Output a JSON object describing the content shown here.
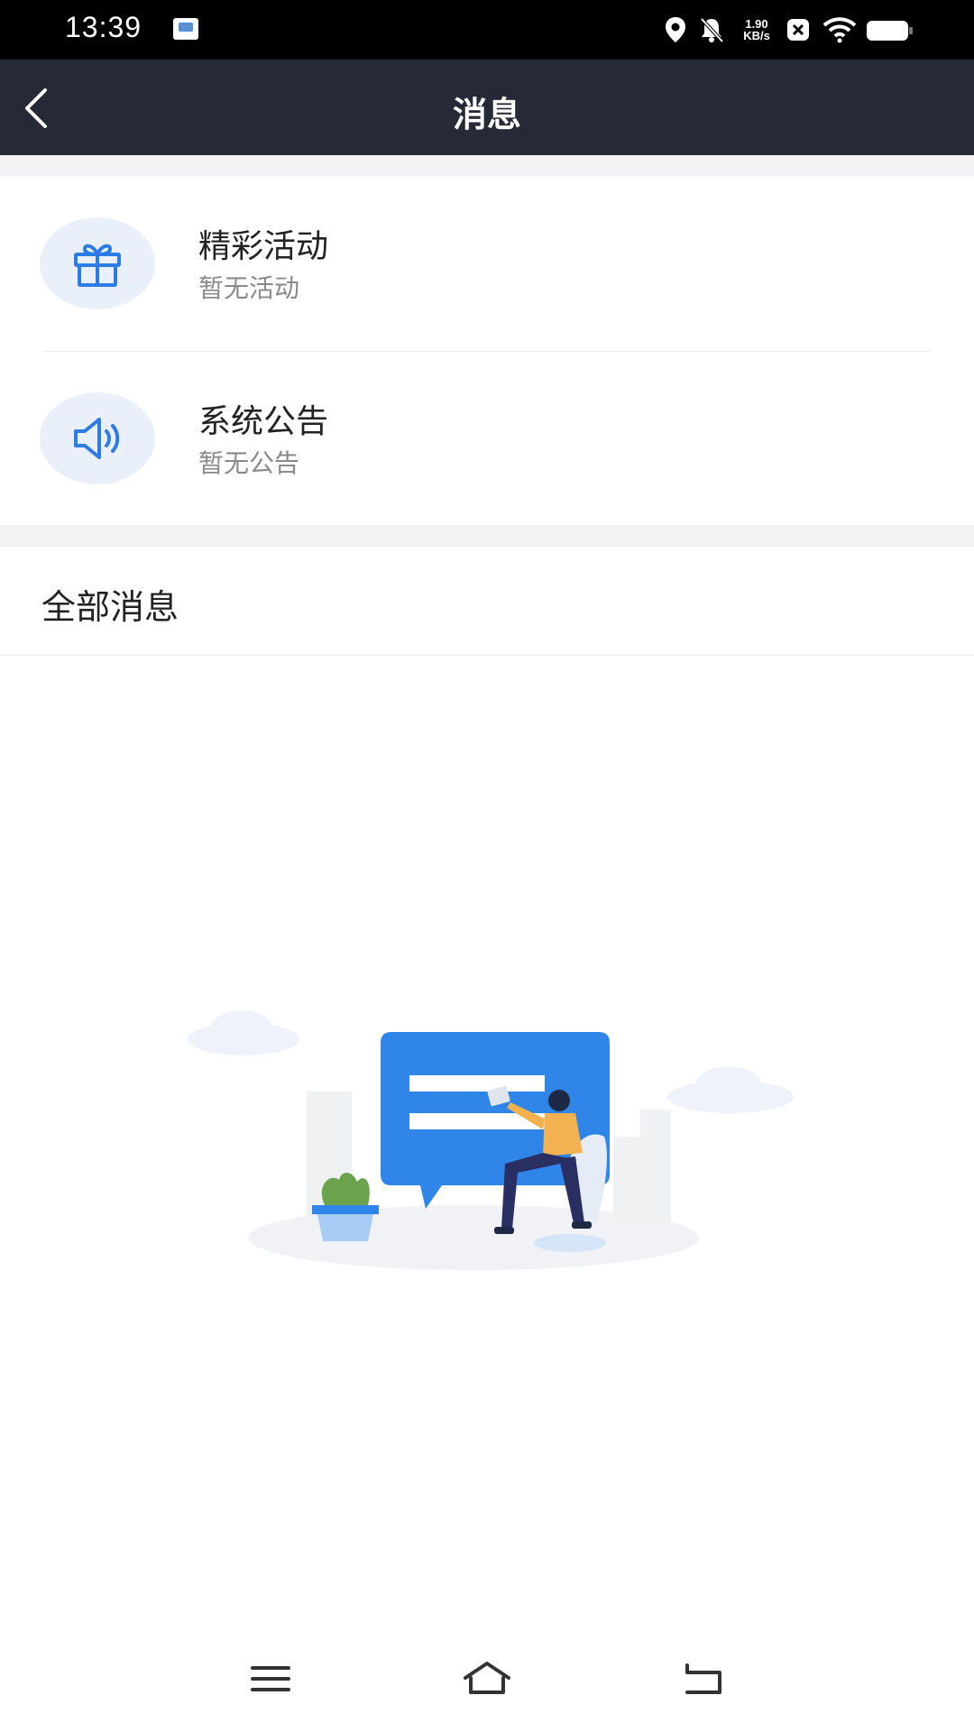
{
  "status_bar": {
    "time": "13:39",
    "net_speed_value": "1.90",
    "net_speed_unit": "KB/s",
    "icons": [
      "app-thumbnail-icon",
      "location-icon",
      "bell-muted-icon",
      "close-box-icon",
      "wifi-icon",
      "battery-icon"
    ]
  },
  "header": {
    "title": "消息",
    "back_icon": "chevron-left-icon"
  },
  "entries": [
    {
      "title": "精彩活动",
      "subtitle": "暂无活动",
      "icon": "gift-icon"
    },
    {
      "title": "系统公告",
      "subtitle": "暂无公告",
      "icon": "speaker-icon"
    }
  ],
  "all_messages": {
    "title": "全部消息"
  },
  "empty_state": {
    "illustration": "empty-messages-illustration"
  },
  "nav_bar": {
    "icons": [
      "menu-icon",
      "home-icon",
      "back-icon"
    ]
  },
  "colors": {
    "header_bg": "#262936",
    "icon_blue": "#2d7be5",
    "icon_bg": "#e9f0fa",
    "separator": "#f2f2f4"
  }
}
